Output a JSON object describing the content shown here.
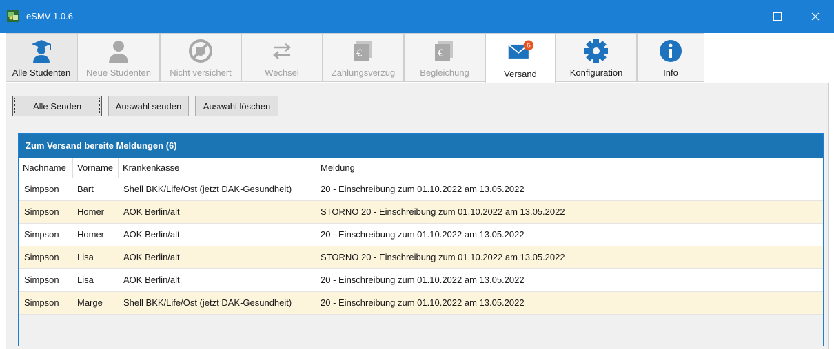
{
  "window": {
    "title": "eSMV 1.0.6"
  },
  "toolbar": {
    "items": [
      {
        "label": "Alle Studenten",
        "icon": "student-graduate-icon",
        "state": "selected"
      },
      {
        "label": "Neue Studenten",
        "icon": "new-student-icon",
        "state": "disabled"
      },
      {
        "label": "Nicht versichert",
        "icon": "not-insured-icon",
        "state": "disabled"
      },
      {
        "label": "Wechsel",
        "icon": "swap-arrows-icon",
        "state": "disabled"
      },
      {
        "label": "Zahlungsverzug",
        "icon": "payment-default-icon",
        "state": "disabled"
      },
      {
        "label": "Begleichung",
        "icon": "settlement-icon",
        "state": "disabled"
      },
      {
        "label": "Versand",
        "icon": "mail-icon",
        "state": "active",
        "badge": "6"
      },
      {
        "label": "Konfiguration",
        "icon": "gear-icon",
        "state": "normal"
      },
      {
        "label": "Info",
        "icon": "info-icon",
        "state": "normal"
      }
    ]
  },
  "actions": {
    "send_all": "Alle Senden",
    "send_selection": "Auswahl senden",
    "delete_selection": "Auswahl löschen"
  },
  "grid": {
    "title": "Zum Versand bereite Meldungen (6)",
    "columns": [
      "Nachname",
      "Vorname",
      "Krankenkasse",
      "Meldung"
    ],
    "rows": [
      [
        "Simpson",
        "Bart",
        "Shell BKK/Life/Ost (jetzt DAK-Gesundheit)",
        "20 - Einschreibung zum 01.10.2022 am 13.05.2022"
      ],
      [
        "Simpson",
        "Homer",
        "AOK Berlin/alt",
        "STORNO 20 - Einschreibung zum 01.10.2022 am 13.05.2022"
      ],
      [
        "Simpson",
        "Homer",
        "AOK Berlin/alt",
        "20 - Einschreibung zum 01.10.2022 am 13.05.2022"
      ],
      [
        "Simpson",
        "Lisa",
        "AOK Berlin/alt",
        "STORNO 20 - Einschreibung zum 01.10.2022 am 13.05.2022"
      ],
      [
        "Simpson",
        "Lisa",
        "AOK Berlin/alt",
        "20 - Einschreibung zum 01.10.2022 am 13.05.2022"
      ],
      [
        "Simpson",
        "Marge",
        "Shell BKK/Life/Ost (jetzt DAK-Gesundheit)",
        "20 - Einschreibung zum 01.10.2022 am 13.05.2022"
      ]
    ]
  },
  "colors": {
    "titlebar": "#1b7fd6",
    "grid_header": "#1b74b4",
    "row_alt": "#fdf4dc",
    "accent": "#1e73be",
    "badge": "#e8531f"
  }
}
